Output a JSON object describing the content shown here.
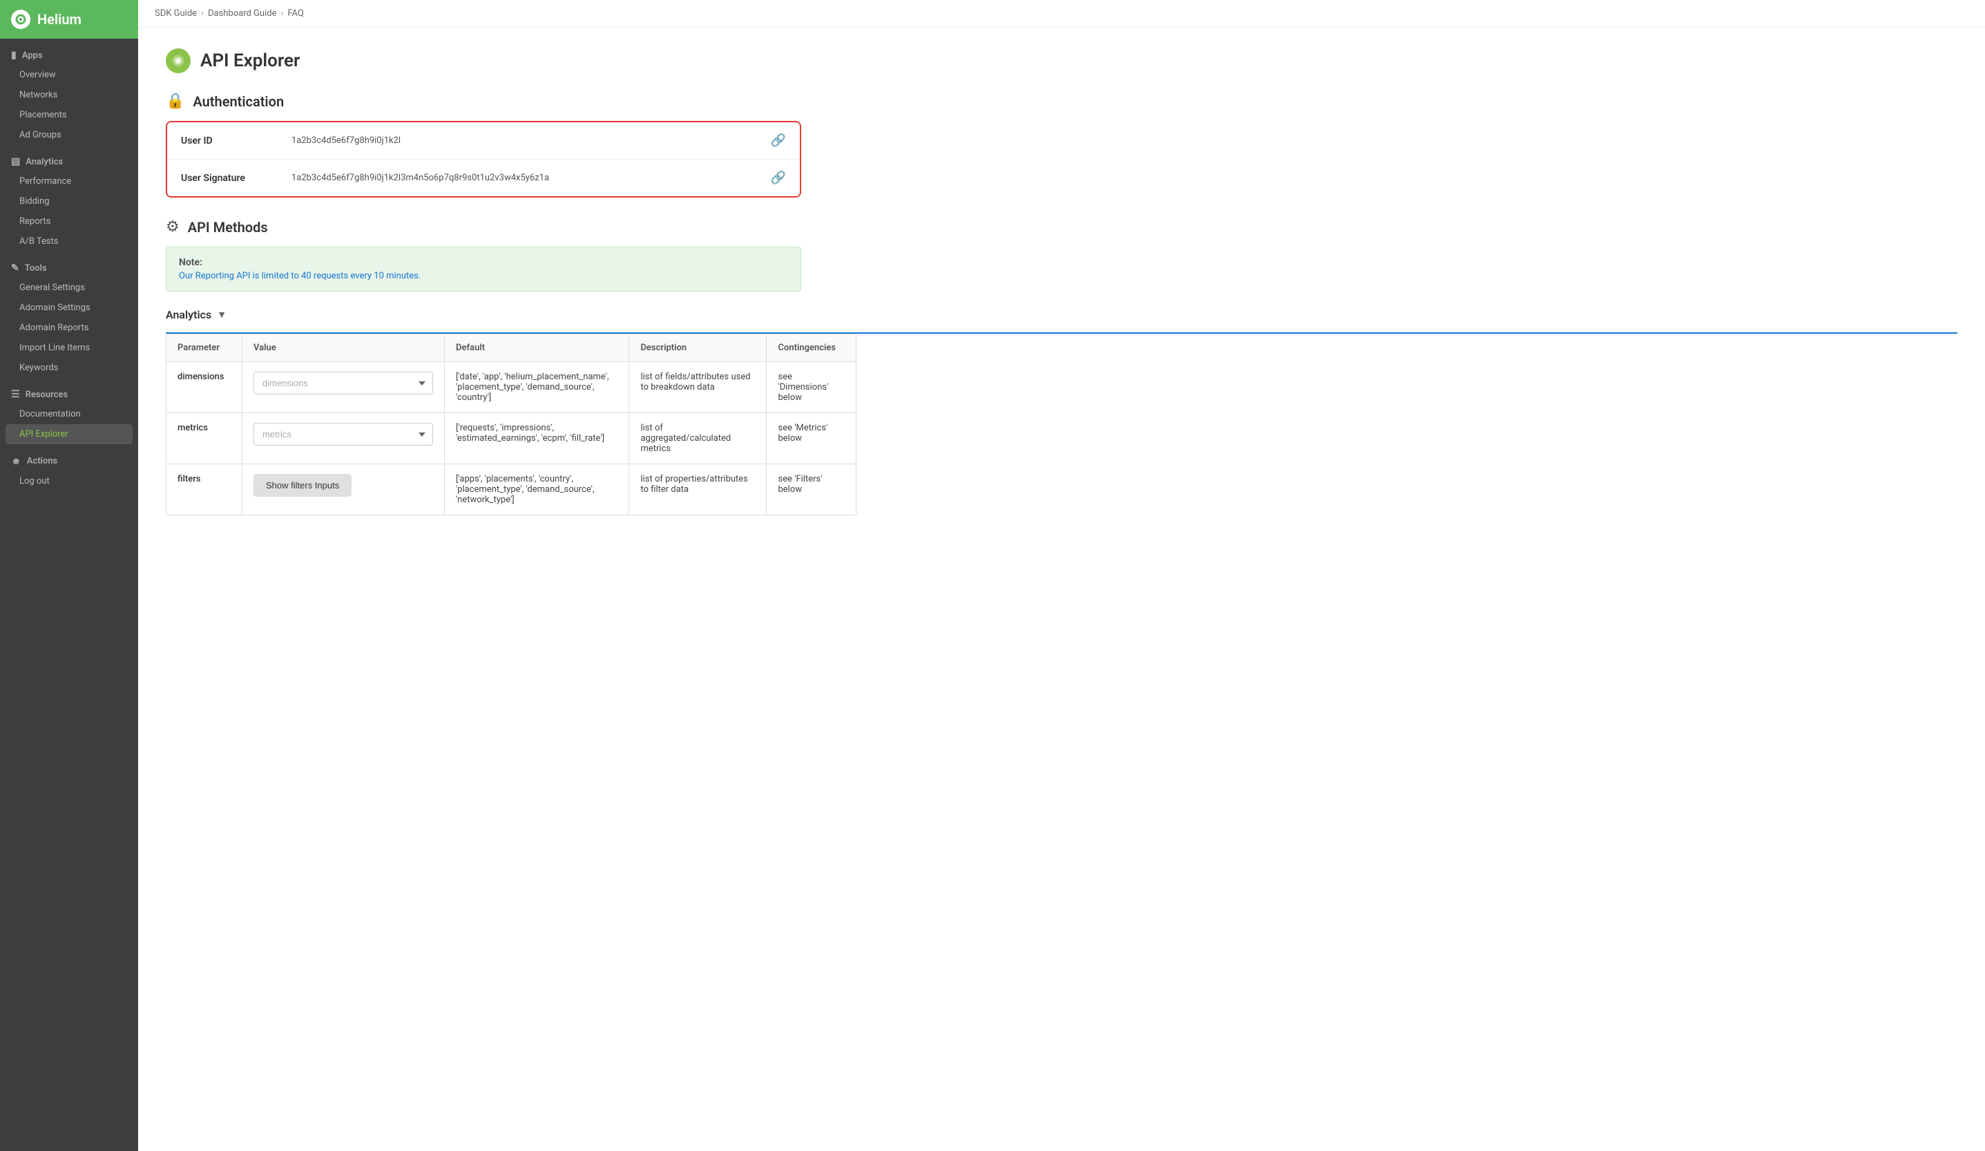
{
  "app": {
    "name": "Helium"
  },
  "breadcrumb": {
    "items": [
      "SDK Guide",
      "Dashboard Guide",
      "FAQ"
    ],
    "separators": [
      "›",
      "›"
    ]
  },
  "page": {
    "title": "API Explorer",
    "title_icon": "api-icon"
  },
  "sidebar": {
    "sections": [
      {
        "label": "Apps",
        "icon": "mobile-icon",
        "items": [
          "Overview",
          "Networks",
          "Placements",
          "Ad Groups"
        ]
      },
      {
        "label": "Analytics",
        "icon": "chart-icon",
        "items": [
          "Performance",
          "Bidding",
          "Reports",
          "A/B Tests"
        ]
      },
      {
        "label": "Tools",
        "icon": "wrench-icon",
        "items": [
          "General Settings",
          "Adomain Settings",
          "Adomain Reports",
          "Import Line Items",
          "Keywords"
        ]
      },
      {
        "label": "Resources",
        "icon": "menu-icon",
        "items": [
          "Documentation",
          "API Explorer"
        ]
      },
      {
        "label": "Actions",
        "icon": "user-icon",
        "items": [
          "Log out"
        ]
      }
    ],
    "active_item": "API Explorer"
  },
  "authentication": {
    "section_title": "Authentication",
    "fields": [
      {
        "label": "User ID",
        "value": "1a2b3c4d5e6f7g8h9i0j1k2l"
      },
      {
        "label": "User Signature",
        "value": "1a2b3c4d5e6f7g8h9i0j1k2l3m4n5o6p7q8r9s0t1u2v3w4x5y6z1a"
      }
    ]
  },
  "api_methods": {
    "section_title": "API Methods",
    "note_title": "Note:",
    "note_text": "Our Reporting API is limited to 40 requests every 10 minutes.",
    "analytics_label": "Analytics",
    "table": {
      "headers": [
        "Parameter",
        "Value",
        "Default",
        "Description",
        "Contingencies"
      ],
      "rows": [
        {
          "parameter": "dimensions",
          "value_placeholder": "dimensions",
          "default": "['date', 'app', 'helium_placement_name', 'placement_type', 'demand_source', 'country']",
          "description": "list of fields/attributes used to breakdown data",
          "contingencies": "see 'Dimensions' below"
        },
        {
          "parameter": "metrics",
          "value_placeholder": "metrics",
          "default": "['requests', 'impressions', 'estimated_earnings', 'ecpm', 'fill_rate']",
          "description": "list of aggregated/calculated metrics",
          "contingencies": "see 'Metrics' below"
        },
        {
          "parameter": "filters",
          "value_button": "Show filters Inputs",
          "default": "['apps', 'placements', 'country', 'placement_type', 'demand_source', 'network_type']",
          "description": "list of properties/attributes to filter data",
          "contingencies": "see 'Filters' below"
        }
      ]
    }
  }
}
